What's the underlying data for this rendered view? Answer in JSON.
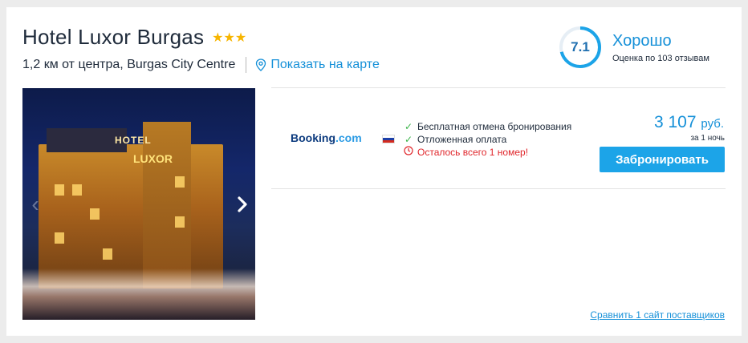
{
  "hotel": {
    "name": "Hotel Luxor Burgas",
    "stars": "★★★",
    "star_count": 3,
    "distance": "1,2 км от центра, Burgas City Centre",
    "map_link": "Показать на карте"
  },
  "rating": {
    "score": "7.1",
    "score_value": 7.1,
    "label": "Хорошо",
    "reviews": "Оценка по 103 отзывам"
  },
  "photo": {
    "sign_hotel": "HOTEL",
    "sign_luxor": "LUXOR",
    "prev_icon": "chevron-left-icon",
    "next_icon": "chevron-right-icon"
  },
  "offer": {
    "provider_part1": "Booking",
    "provider_part2": ".com",
    "features": [
      "Бесплатная отмена бронирования",
      "Отложенная оплата"
    ],
    "warning": "Осталось всего 1 номер!",
    "price": "3 107",
    "currency": "руб.",
    "per_night": "за 1 ночь",
    "book_button": "Забронировать"
  },
  "compare_link": "Сравнить 1 сайт поставщиков",
  "colors": {
    "accent": "#1590d8",
    "button": "#1ca4e8",
    "stars": "#f7b500",
    "warning": "#e0262b",
    "check": "#3bb54a"
  }
}
